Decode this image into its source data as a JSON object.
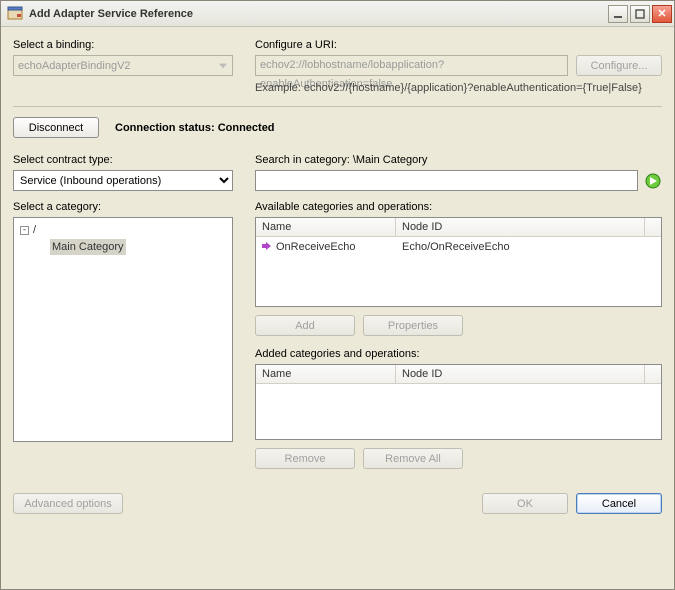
{
  "window": {
    "title": "Add Adapter Service Reference"
  },
  "binding": {
    "label": "Select a binding:",
    "value": "echoAdapterBindingV2"
  },
  "uri": {
    "label": "Configure a URI:",
    "value": "echov2://lobhostname/lobapplication?enableAuthentication=false",
    "configure_btn": "Configure...",
    "example": "Example: echov2://{hostname}/{application}?enableAuthentication={True|False}"
  },
  "connection": {
    "disconnect_btn": "Disconnect",
    "status_label": "Connection status:",
    "status_value": "Connected"
  },
  "contract": {
    "label": "Select contract type:",
    "value": "Service (Inbound operations)"
  },
  "search": {
    "label": "Search in category: \\Main Category",
    "value": ""
  },
  "category": {
    "label": "Select a category:",
    "root": "/",
    "items": [
      "Main Category"
    ]
  },
  "available": {
    "label": "Available categories and operations:",
    "columns": [
      "Name",
      "Node ID"
    ],
    "rows": [
      {
        "name": "OnReceiveEcho",
        "node_id": "Echo/OnReceiveEcho"
      }
    ],
    "add_btn": "Add",
    "props_btn": "Properties"
  },
  "added": {
    "label": "Added categories and operations:",
    "columns": [
      "Name",
      "Node ID"
    ],
    "remove_btn": "Remove",
    "remove_all_btn": "Remove All"
  },
  "footer": {
    "advanced": "Advanced options",
    "ok": "OK",
    "cancel": "Cancel"
  }
}
